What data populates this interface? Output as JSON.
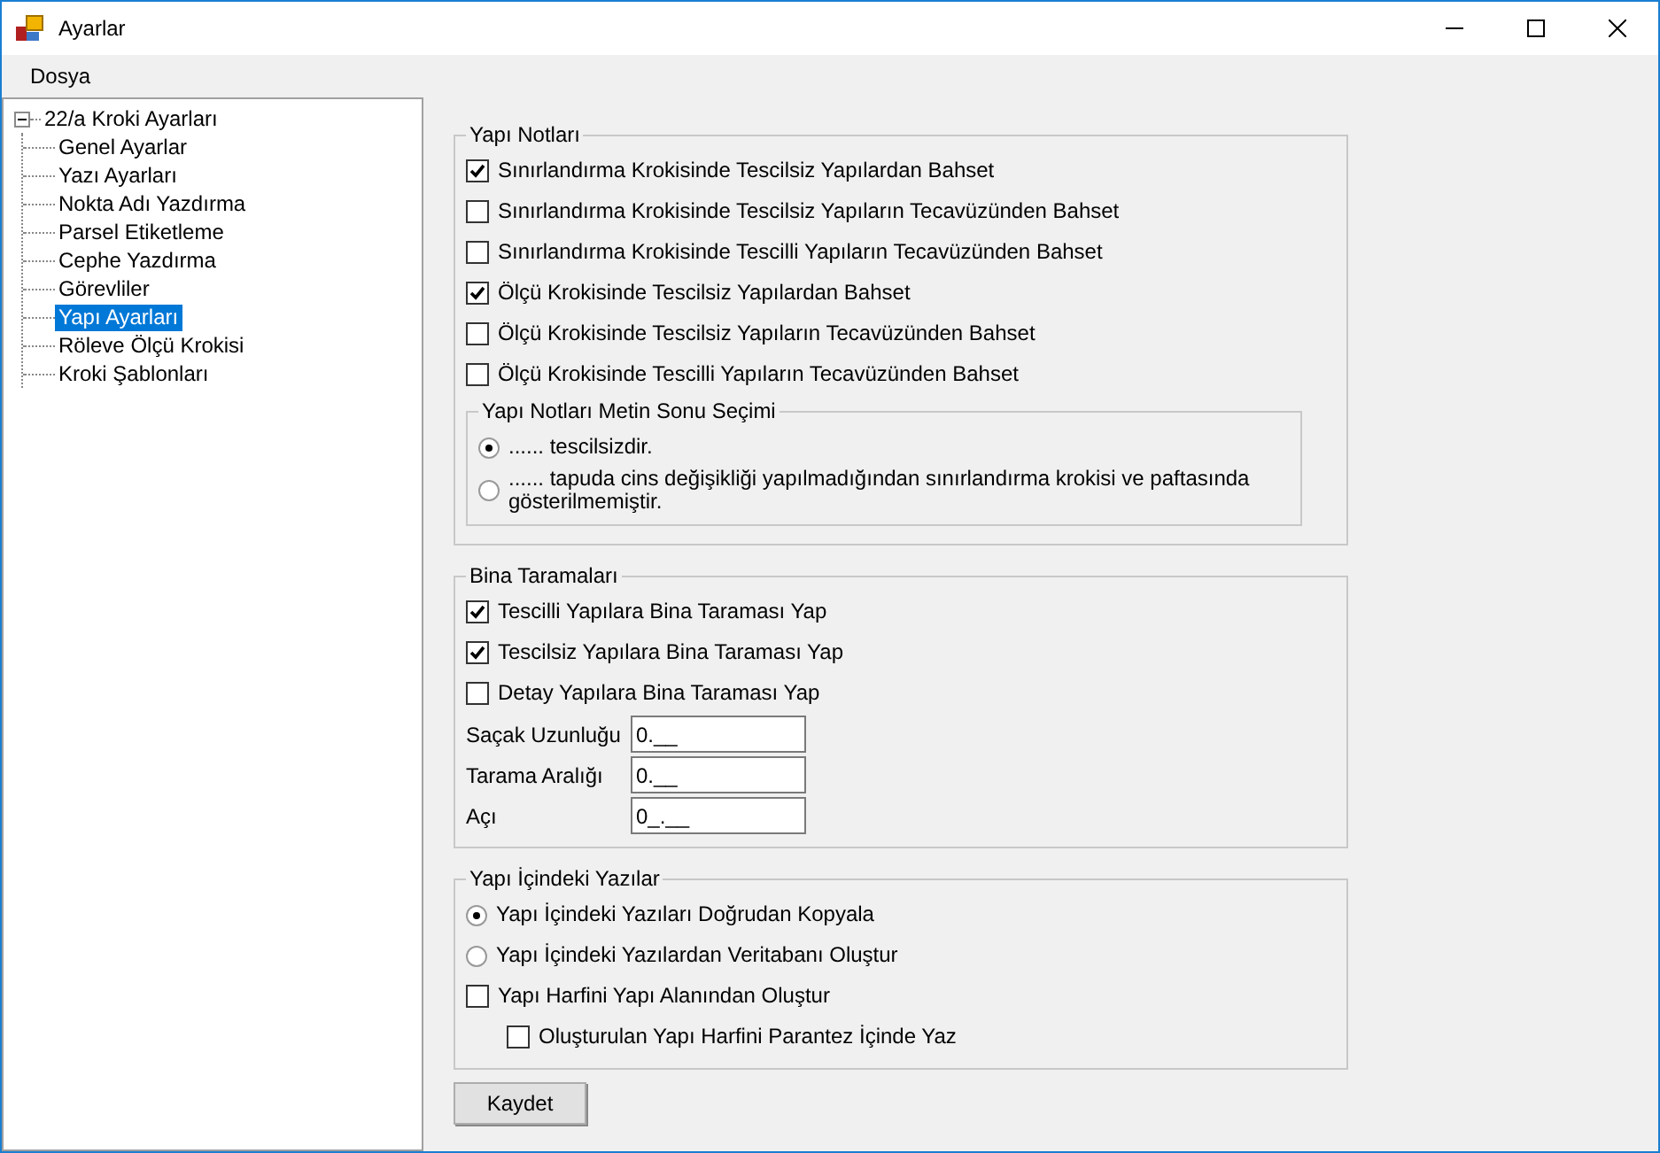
{
  "window": {
    "title": "Ayarlar"
  },
  "menu": [
    "Dosya"
  ],
  "tree": [
    {
      "label": "22/a Kroki Ayarları",
      "expanded": true,
      "selected": false,
      "children": [
        {
          "label": "Genel Ayarlar",
          "selected": false
        },
        {
          "label": "Yazı Ayarları",
          "selected": false
        },
        {
          "label": "Nokta Adı Yazdırma",
          "selected": false
        },
        {
          "label": "Parsel Etiketleme",
          "selected": false
        },
        {
          "label": "Cephe Yazdırma",
          "selected": false
        },
        {
          "label": "Görevliler",
          "selected": false
        },
        {
          "label": "Yapı Ayarları",
          "selected": true
        },
        {
          "label": "Röleve Ölçü Krokisi",
          "selected": false
        },
        {
          "label": "Kroki Şablonları",
          "selected": false
        }
      ]
    }
  ],
  "yapi_notlari": {
    "title": "Yapı Notları",
    "checkboxes": [
      {
        "label": "Sınırlandırma Krokisinde Tescilsiz Yapılardan Bahset",
        "checked": true
      },
      {
        "label": "Sınırlandırma Krokisinde Tescilsiz Yapıların Tecavüzünden Bahset",
        "checked": false
      },
      {
        "label": "Sınırlandırma Krokisinde Tescilli Yapıların Tecavüzünden Bahset",
        "checked": false
      },
      {
        "label": "Ölçü Krokisinde Tescilsiz Yapılardan Bahset",
        "checked": true
      },
      {
        "label": "Ölçü Krokisinde Tescilsiz Yapıların Tecavüzünden Bahset",
        "checked": false
      },
      {
        "label": "Ölçü Krokisinde Tescilli Yapıların Tecavüzünden Bahset",
        "checked": false
      }
    ],
    "subgroup": {
      "title": "Yapı Notları Metin Sonu Seçimi",
      "options": [
        {
          "label": "...... tescilsizdir.",
          "selected": true
        },
        {
          "label": "...... tapuda cins değişikliği yapılmadığından sınırlandırma krokisi ve paftasında gösterilmemiştir.",
          "selected": false
        }
      ]
    }
  },
  "bina_taramalari": {
    "title": "Bina Taramaları",
    "checkboxes": [
      {
        "label": "Tescilli Yapılara Bina Taraması Yap",
        "checked": true
      },
      {
        "label": "Tescilsiz Yapılara Bina Taraması Yap",
        "checked": true
      },
      {
        "label": "Detay Yapılara Bina Taraması Yap",
        "checked": false
      }
    ],
    "fields": [
      {
        "label": "Saçak Uzunluğu",
        "value": "0.__"
      },
      {
        "label": "Tarama Aralığı",
        "value": "0.__"
      },
      {
        "label": "Açı",
        "value": "0_.__"
      }
    ]
  },
  "yapi_icindeki_yazilar": {
    "title": "Yapı İçindeki Yazılar",
    "options": [
      {
        "label": "Yapı İçindeki Yazıları Doğrudan Kopyala",
        "selected": true
      },
      {
        "label": "Yapı İçindeki Yazılardan Veritabanı Oluştur",
        "selected": false
      }
    ],
    "checkboxes": [
      {
        "label": "Yapı Harfini Yapı Alanından Oluştur",
        "checked": false,
        "children": [
          {
            "label": "Oluşturulan Yapı Harfini Parantez İçinde Yaz",
            "checked": false
          }
        ]
      }
    ]
  },
  "save_button": "Kaydet"
}
